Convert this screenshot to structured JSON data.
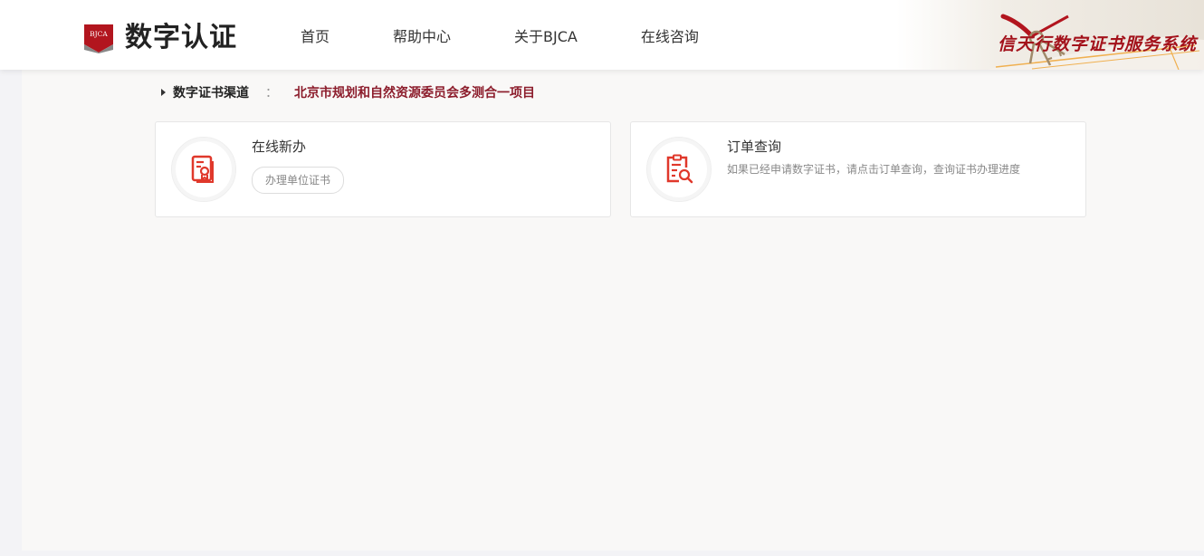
{
  "header": {
    "logo_badge": "BJCA",
    "logo_text": "数字认证",
    "nav": [
      "首页",
      "帮助中心",
      "关于BJCA",
      "在线咨询"
    ],
    "banner_title": "信天行数字证书服务系统"
  },
  "breadcrumb": {
    "label": "数字证书渠道",
    "separator": "：",
    "project": "北京市规划和自然资源委员会多测合一项目"
  },
  "cards": [
    {
      "title": "在线新办",
      "button": "办理单位证书",
      "icon": "certificate-document-icon"
    },
    {
      "title": "订单查询",
      "description": "如果已经申请数字证书，请点击订单查询，查询证书办理进度",
      "icon": "order-search-icon"
    }
  ],
  "colors": {
    "accent": "#e0382b",
    "brand": "#a3121b",
    "project_text": "#8c1d2c"
  }
}
